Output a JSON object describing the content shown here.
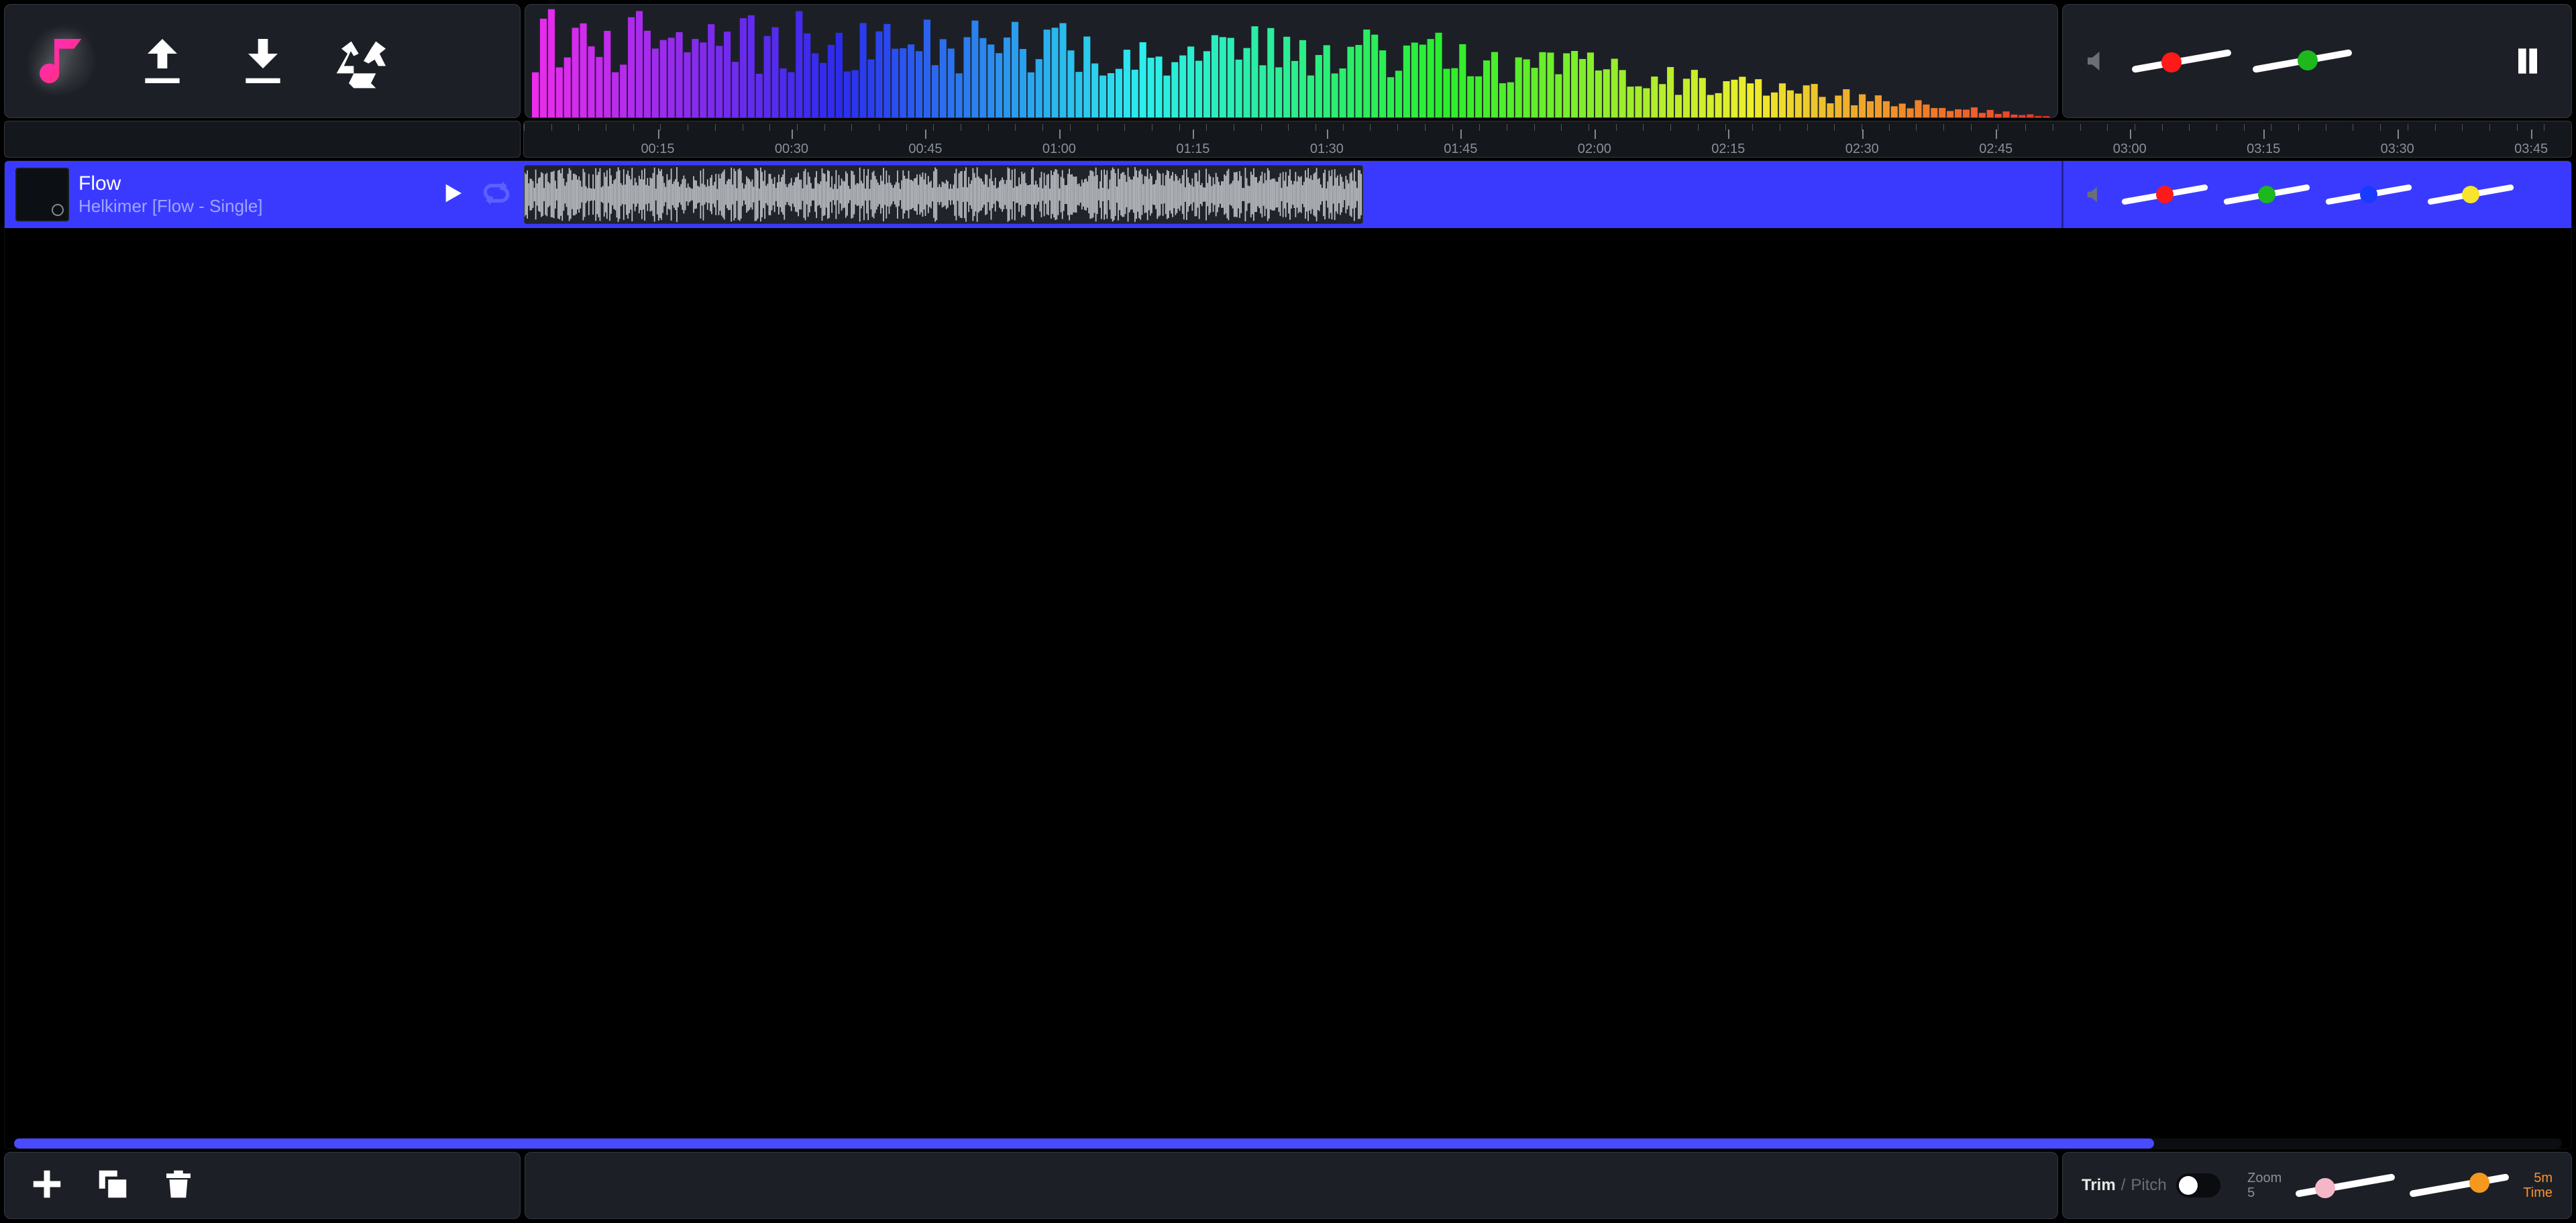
{
  "toolbar": {
    "spectrum_bars": 190
  },
  "ruler": {
    "labels": [
      "00:15",
      "00:30",
      "00:45",
      "01:00",
      "01:15",
      "01:30",
      "01:45",
      "02:00",
      "02:15",
      "02:30",
      "02:45",
      "03:00",
      "03:15",
      "03:30",
      "03:45"
    ]
  },
  "track": {
    "title": "Flow",
    "subtitle": "Helkimer [Flow - Single]",
    "clip_width_pct": 54.5
  },
  "scrollbar": {
    "handle_pct": 84
  },
  "footer": {
    "trim_label": "Trim",
    "pitch_label": "Pitch",
    "sep": "/",
    "zoom_label": "Zoom",
    "zoom_value": "5",
    "zoom_end_top": "5m",
    "zoom_end_bottom": "Time"
  },
  "sliders": {
    "top": [
      {
        "color": "red",
        "pos": 40
      },
      {
        "color": "green",
        "pos": 55
      }
    ],
    "track": [
      {
        "color": "red",
        "pos": 50
      },
      {
        "color": "green",
        "pos": 50
      },
      {
        "color": "blue",
        "pos": 50
      },
      {
        "color": "yellow",
        "pos": 50
      }
    ],
    "zoom": [
      {
        "color": "pink",
        "pos": 30
      },
      {
        "color": "orange",
        "pos": 70
      }
    ]
  }
}
